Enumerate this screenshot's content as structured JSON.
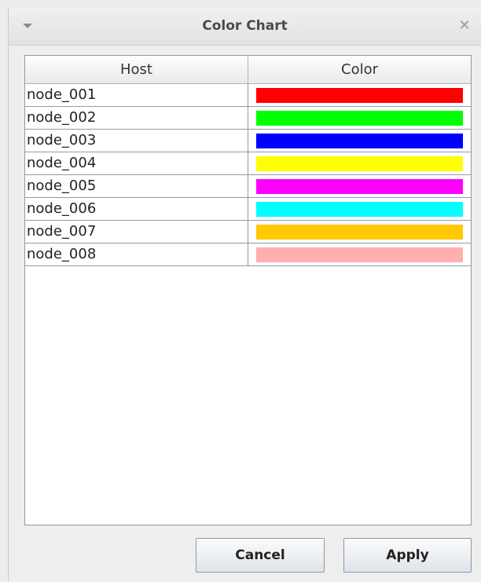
{
  "window": {
    "title": "Color Chart"
  },
  "table": {
    "columns": [
      "Host",
      "Color"
    ],
    "rows": [
      {
        "host": "node_001",
        "color": "#ff0000"
      },
      {
        "host": "node_002",
        "color": "#00ff00"
      },
      {
        "host": "node_003",
        "color": "#0000ff"
      },
      {
        "host": "node_004",
        "color": "#ffff00"
      },
      {
        "host": "node_005",
        "color": "#ff00ff"
      },
      {
        "host": "node_006",
        "color": "#00ffff"
      },
      {
        "host": "node_007",
        "color": "#ffc800"
      },
      {
        "host": "node_008",
        "color": "#ffafaf"
      }
    ]
  },
  "buttons": {
    "cancel_label": "Cancel",
    "apply_label": "Apply"
  },
  "icons": {
    "window_menu": "triangle-down-icon",
    "close": "close-icon"
  }
}
